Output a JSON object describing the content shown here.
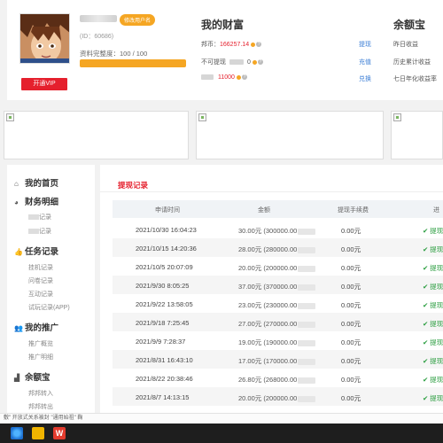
{
  "profile": {
    "edit_label": "修改用户名",
    "id_text": "(ID：60686)",
    "completeness_label": "资料完整度：",
    "completeness_value": "100 / 100",
    "completeness_fraction": 1.0,
    "vip_label": "开通VIP"
  },
  "wealth": {
    "title": "我的财富",
    "rows": [
      {
        "label": "邦币：",
        "value": "166257.14",
        "action": "提现"
      },
      {
        "label": "不可提现",
        "value": "0",
        "action": "充值"
      },
      {
        "label": "",
        "value": "11000",
        "action": "兑换"
      }
    ]
  },
  "yuebao": {
    "title": "余额宝",
    "rows": [
      "昨日收益",
      "历史累计收益",
      "七日年化收益率"
    ]
  },
  "sidebar": {
    "sections": [
      {
        "icon": "home-icon",
        "label": "我的首页",
        "items": []
      },
      {
        "icon": "pie-chart-icon",
        "label": "财务明细",
        "items": [
          "记录",
          "记录"
        ]
      },
      {
        "icon": "thumbs-up-icon",
        "label": "任务记录",
        "items": [
          "挂机记录",
          "问卷记录",
          "互动记录",
          "试玩记录(APP)"
        ]
      },
      {
        "icon": "users-icon",
        "label": "我的推广",
        "items": [
          "推广概览",
          "推广明细"
        ]
      },
      {
        "icon": "bar-chart-icon",
        "label": "余额宝",
        "items": [
          "邦邦转入",
          "邦邦转出"
        ]
      }
    ]
  },
  "withdraw": {
    "title": "提现记录",
    "columns": [
      "申请时间",
      "金额",
      "提现手续费",
      "进"
    ],
    "rows": [
      {
        "time": "2021/10/30 16:04:23",
        "amount": "30.00元 (300000.00",
        "fee": "0.00元",
        "status": "提现"
      },
      {
        "time": "2021/10/15 14:20:36",
        "amount": "28.00元 (280000.00",
        "fee": "0.00元",
        "status": "提现"
      },
      {
        "time": "2021/10/5 20:07:09",
        "amount": "20.00元 (200000.00",
        "fee": "0.00元",
        "status": "提现"
      },
      {
        "time": "2021/9/30 8:05:25",
        "amount": "37.00元 (370000.00",
        "fee": "0.00元",
        "status": "提现"
      },
      {
        "time": "2021/9/22 13:58:05",
        "amount": "23.00元 (230000.00",
        "fee": "0.00元",
        "status": "提现"
      },
      {
        "time": "2021/9/18 7:25:45",
        "amount": "27.00元 (270000.00",
        "fee": "0.00元",
        "status": "提现"
      },
      {
        "time": "2021/9/9 7:28:37",
        "amount": "19.00元 (190000.00",
        "fee": "0.00元",
        "status": "提现"
      },
      {
        "time": "2021/8/31 16:43:10",
        "amount": "17.00元 (170000.00",
        "fee": "0.00元",
        "status": "提现"
      },
      {
        "time": "2021/8/22 20:38:46",
        "amount": "26.80元 (268000.00",
        "fee": "0.00元",
        "status": "提现"
      },
      {
        "time": "2021/8/7 14:13:15",
        "amount": "20.00元 (200000.00",
        "fee": "0.00元",
        "status": "提现"
      }
    ]
  },
  "statusbar": {
    "text": "敷\" 开放式关系被封 \"通用始祖\" 鞠"
  },
  "colors": {
    "accent_red": "#e5202d",
    "gold": "#f5a623",
    "link_blue": "#3d7fd6",
    "success_green": "#2a9d3f"
  }
}
